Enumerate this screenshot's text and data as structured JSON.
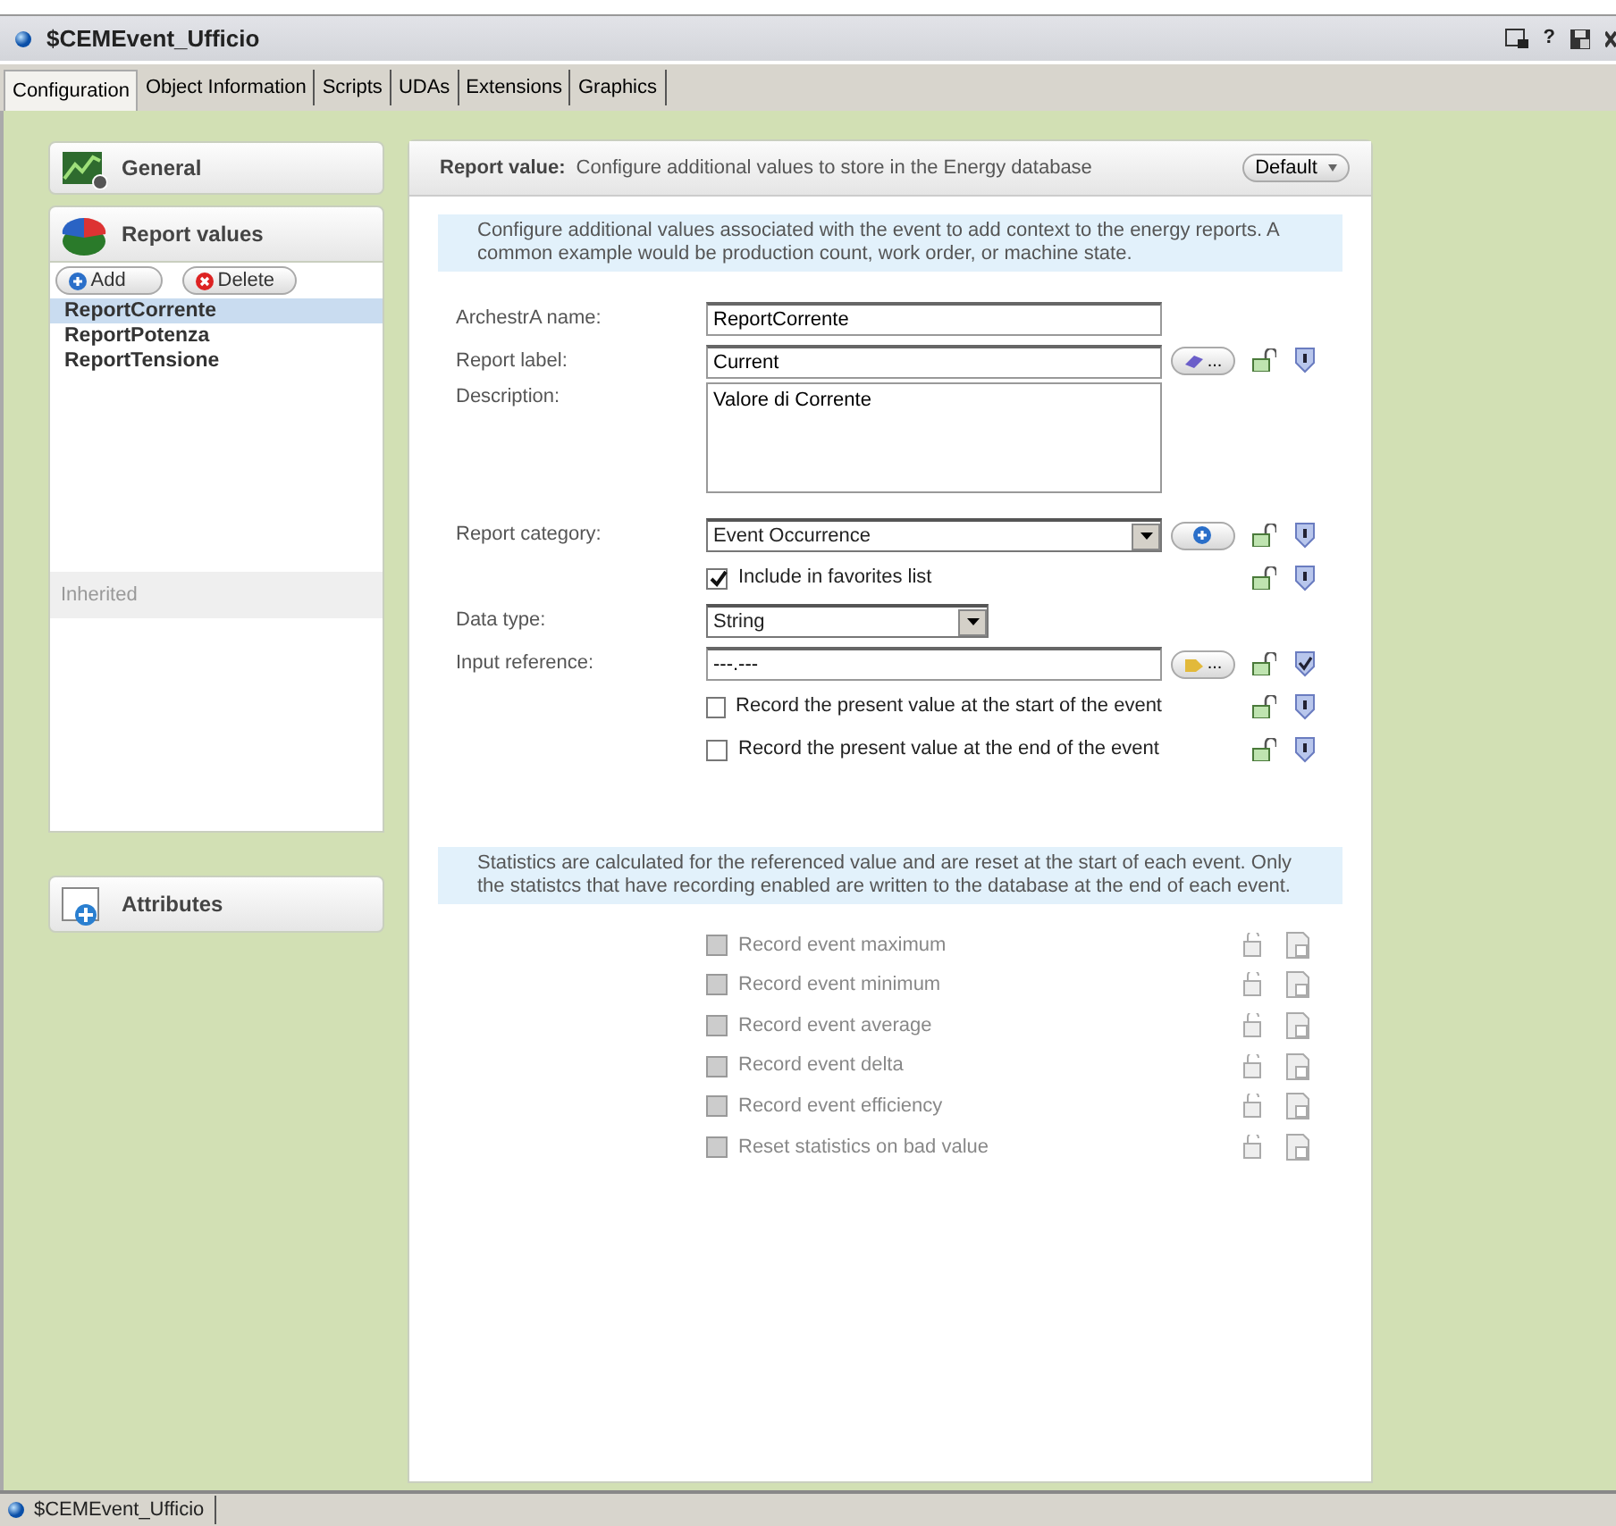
{
  "window": {
    "title": "$CEMEvent_Ufficio",
    "help": "?"
  },
  "tabs": [
    {
      "label": "Configuration",
      "selected": true
    },
    {
      "label": "Object Information",
      "selected": false
    },
    {
      "label": "Scripts",
      "selected": false
    },
    {
      "label": "UDAs",
      "selected": false
    },
    {
      "label": "Extensions",
      "selected": false
    },
    {
      "label": "Graphics",
      "selected": false
    }
  ],
  "sidebar": {
    "sections": [
      {
        "kind": "general",
        "title": "General",
        "expanded": false
      },
      {
        "kind": "report",
        "title": "Report values",
        "expanded": true
      },
      {
        "kind": "attributes",
        "title": "Attributes",
        "expanded": false
      }
    ],
    "buttons": [
      {
        "kind": "add",
        "label": "Add"
      },
      {
        "kind": "delete",
        "label": "Delete"
      }
    ],
    "items": [
      {
        "label": "ReportCorrente",
        "selected": true
      },
      {
        "label": "ReportPotenza",
        "selected": false
      },
      {
        "label": "ReportTensione",
        "selected": false
      }
    ],
    "inherited_label": "Inherited"
  },
  "panel": {
    "title": "Report value:",
    "subtitle": "Configure additional values to store in the Energy database",
    "default_button": "Default",
    "info": "Configure additional values associated with the event to add context to the energy reports. A common example would be production count, work order, or machine state.",
    "fields": [
      {
        "kind": "text",
        "label": "ArchestrA name:",
        "value": "ReportCorrente",
        "lockable": false
      },
      {
        "kind": "text",
        "label": "Report label:",
        "value": "Current",
        "button": {
          "kind": "label",
          "text": "..."
        },
        "lockable": true,
        "shield_checked": false
      },
      {
        "kind": "textarea",
        "label": "Description:",
        "value": "Valore di Corrente",
        "lockable": false
      },
      {
        "kind": "select",
        "label": "Report category:",
        "value": "Event Occurrence",
        "button": {
          "kind": "add"
        },
        "lockable": true,
        "shield_checked": false
      },
      {
        "kind": "checkbox",
        "label": "Include in favorites list",
        "checked": true,
        "lockable": true,
        "shield_checked": false
      },
      {
        "kind": "select-short",
        "label": "Data type:",
        "value": "String",
        "lockable": false
      },
      {
        "kind": "text",
        "label": "Input reference:",
        "value": "---.---",
        "button": {
          "kind": "reference",
          "text": "..."
        },
        "lockable": true,
        "shield_checked": true
      },
      {
        "kind": "checkbox",
        "label": "Record the present value at the start of the event",
        "checked": false,
        "lockable": true,
        "shield_checked": false
      },
      {
        "kind": "checkbox",
        "label": "Record the present value at the end of the event",
        "checked": false,
        "lockable": true,
        "shield_checked": false
      }
    ],
    "stats_info": "Statistics are calculated for the referenced value and are reset at the start of each event.  Only the statistcs that have recording enabled are written to the database at the end of each event.",
    "statistics": [
      {
        "label": "Record event maximum",
        "checked": false,
        "disabled": true
      },
      {
        "label": "Record event minimum",
        "checked": false,
        "disabled": true
      },
      {
        "label": "Record event average",
        "checked": false,
        "disabled": true
      },
      {
        "label": "Record event delta",
        "checked": false,
        "disabled": true
      },
      {
        "label": "Record event efficiency",
        "checked": false,
        "disabled": true
      },
      {
        "label": "Reset statistics on bad value",
        "checked": false,
        "disabled": true
      }
    ]
  },
  "status_bar": {
    "tab": "$CEMEvent_Ufficio"
  }
}
